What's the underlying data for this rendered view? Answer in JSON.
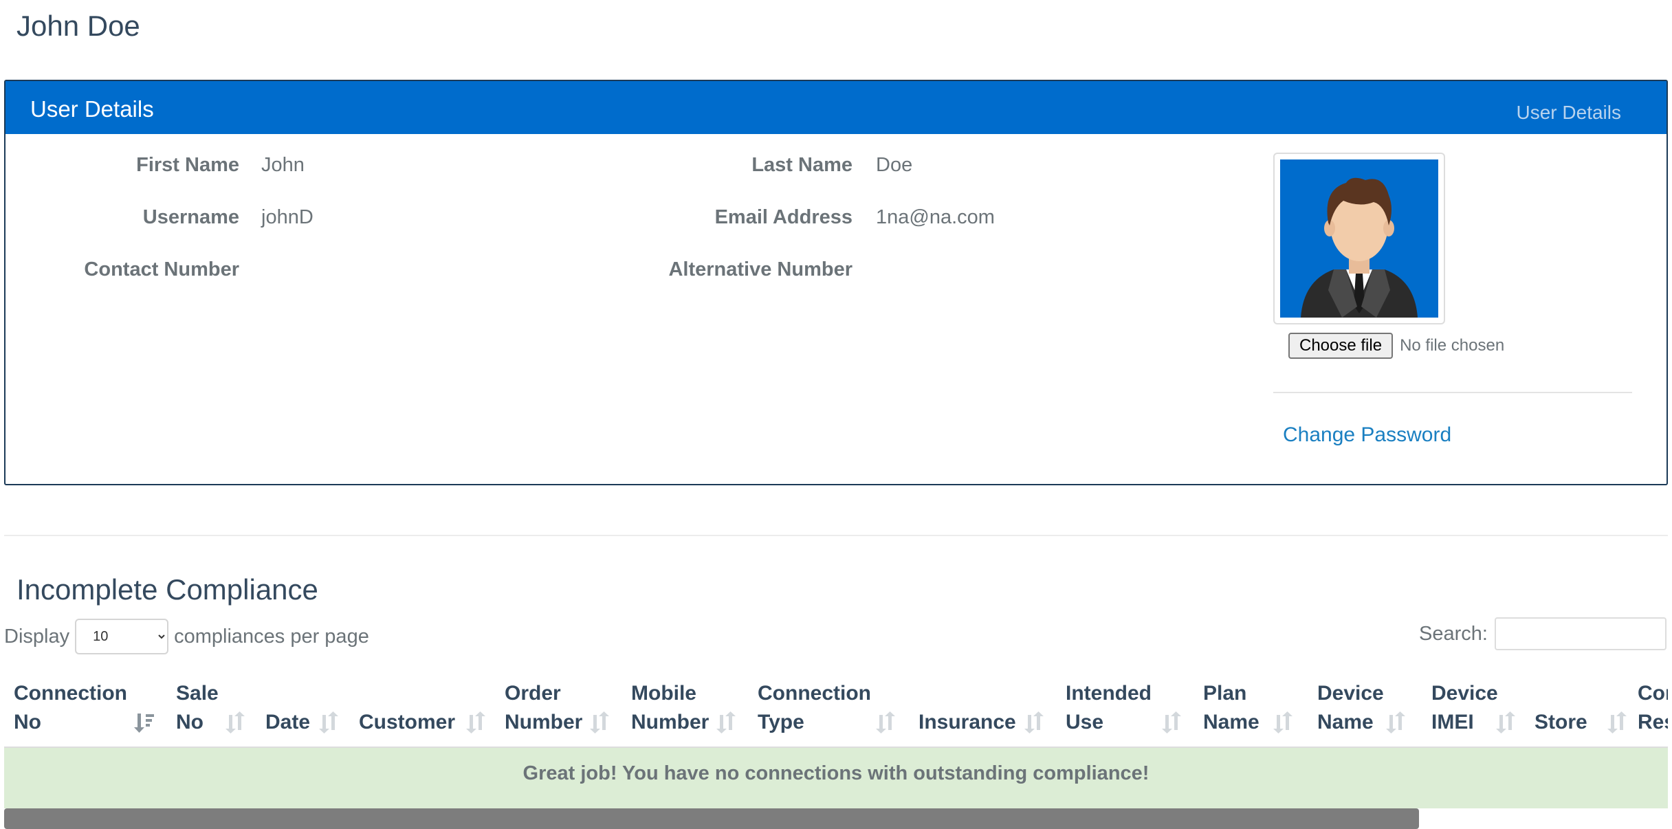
{
  "page": {
    "title": "John Doe"
  },
  "panel": {
    "title": "User Details",
    "header_right": "User Details",
    "fields": {
      "first_name_label": "First Name",
      "first_name_value": "John",
      "last_name_label": "Last Name",
      "last_name_value": "Doe",
      "username_label": "Username",
      "username_value": "johnD",
      "email_label": "Email Address",
      "email_value": "1na@na.com",
      "contact_label": "Contact Number",
      "contact_value": "",
      "alt_label": "Alternative Number",
      "alt_value": ""
    },
    "file": {
      "button_label": "Choose file",
      "status": "No file chosen"
    },
    "change_password": "Change Password",
    "avatar": {
      "background": "#006ccc"
    }
  },
  "compliance": {
    "title": "Incomplete Compliance",
    "display_prefix": "Display",
    "page_size": "10",
    "page_size_options": [
      "10"
    ],
    "display_suffix": "compliances per page",
    "search_label": "Search:",
    "search_value": "",
    "columns": [
      {
        "line1": "Connection",
        "line2": "No",
        "sort": "active-desc"
      },
      {
        "line1": "Sale",
        "line2": "No",
        "sort": "both"
      },
      {
        "line1": "",
        "line2": "Date",
        "sort": "both"
      },
      {
        "line1": "",
        "line2": "Customer",
        "sort": "both"
      },
      {
        "line1": "Order",
        "line2": "Number",
        "sort": "both"
      },
      {
        "line1": "Mobile",
        "line2": "Number",
        "sort": "both"
      },
      {
        "line1": "Connection",
        "line2": "Type",
        "sort": "both"
      },
      {
        "line1": "",
        "line2": "Insurance",
        "sort": "both"
      },
      {
        "line1": "Intended",
        "line2": "Use",
        "sort": "both"
      },
      {
        "line1": "Plan",
        "line2": "Name",
        "sort": "both"
      },
      {
        "line1": "Device",
        "line2": "Name",
        "sort": "both"
      },
      {
        "line1": "Device",
        "line2": "IMEI",
        "sort": "both"
      },
      {
        "line1": "",
        "line2": "Store",
        "sort": "both"
      },
      {
        "line1": "Con",
        "line2": "Res",
        "sort": "none"
      }
    ],
    "empty_message": "Great job! You have no connections with outstanding compliance!"
  },
  "colors": {
    "header_blue": "#006ccc",
    "link_blue": "#1a7fc1",
    "success_bg": "#dcedd5",
    "title_text": "#34495e"
  }
}
